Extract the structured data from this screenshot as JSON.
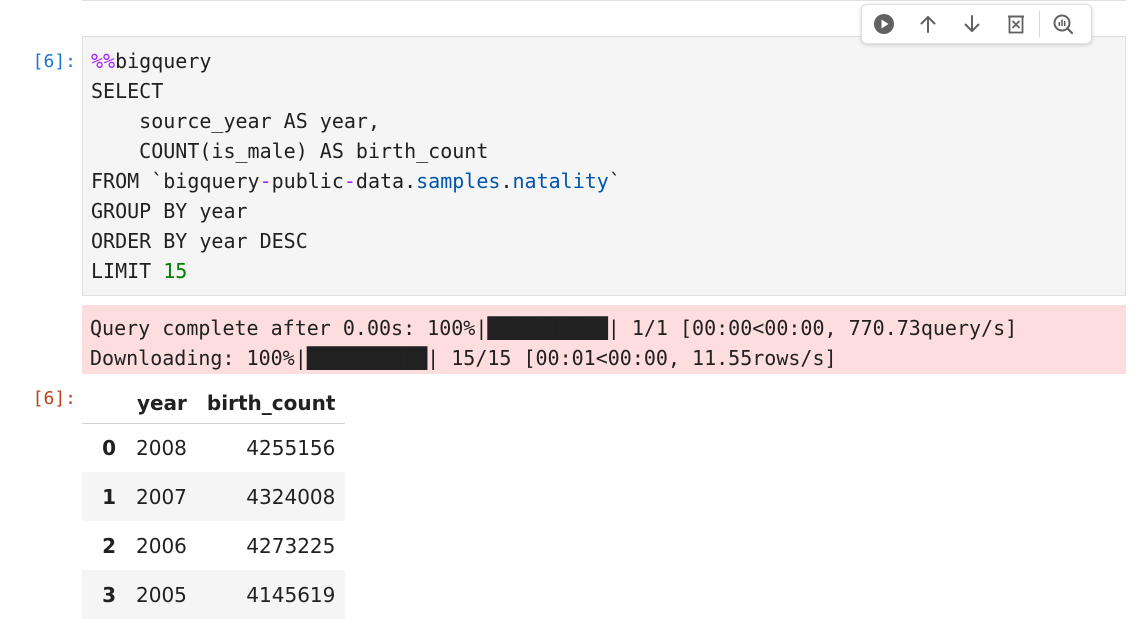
{
  "cell_in": {
    "prompt": "[6]:",
    "code_lines": [
      [
        {
          "t": "%%",
          "c": "magic"
        },
        {
          "t": "bigquery",
          "c": ""
        }
      ],
      [
        {
          "t": "SELECT",
          "c": ""
        }
      ],
      [
        {
          "t": "    source_year AS year,",
          "c": ""
        }
      ],
      [
        {
          "t": "    COUNT(is_male) AS birth_count",
          "c": ""
        }
      ],
      [
        {
          "t": "FROM `bigquery",
          "c": ""
        },
        {
          "t": "-",
          "c": "op"
        },
        {
          "t": "public",
          "c": ""
        },
        {
          "t": "-",
          "c": "op"
        },
        {
          "t": "data.",
          "c": ""
        },
        {
          "t": "samples",
          "c": "attr"
        },
        {
          "t": ".",
          "c": ""
        },
        {
          "t": "natality",
          "c": "attr"
        },
        {
          "t": "`",
          "c": ""
        }
      ],
      [
        {
          "t": "GROUP BY year",
          "c": ""
        }
      ],
      [
        {
          "t": "ORDER BY year DESC",
          "c": ""
        }
      ],
      [
        {
          "t": "LIMIT ",
          "c": ""
        },
        {
          "t": "15",
          "c": "num"
        }
      ]
    ]
  },
  "toolbar": {
    "buttons": [
      {
        "name": "run-cell-button",
        "icon": "run-icon"
      },
      {
        "name": "move-up-button",
        "icon": "arrow-up-icon"
      },
      {
        "name": "move-down-button",
        "icon": "arrow-down-icon"
      },
      {
        "name": "delete-cell-button",
        "icon": "delete-icon"
      },
      {
        "name": "inspect-button",
        "icon": "inspect-icon"
      }
    ]
  },
  "stderr": {
    "line1": "Query complete after 0.00s: 100%|██████████| 1/1 [00:00<00:00, 770.73query/s]",
    "line2": "Downloading: 100%|██████████| 15/15 [00:01<00:00, 11.55rows/s]"
  },
  "cell_out": {
    "prompt": "[6]:",
    "table": {
      "columns": [
        "",
        "year",
        "birth_count"
      ],
      "rows": [
        {
          "index": "0",
          "year": "2008",
          "birth_count": "4255156"
        },
        {
          "index": "1",
          "year": "2007",
          "birth_count": "4324008"
        },
        {
          "index": "2",
          "year": "2006",
          "birth_count": "4273225"
        },
        {
          "index": "3",
          "year": "2005",
          "birth_count": "4145619"
        }
      ]
    }
  },
  "colors": {
    "in_prompt": "#1976d2",
    "out_prompt": "#c0401d",
    "stderr_bg": "#fddddd",
    "code_bg": "#f5f5f5"
  }
}
